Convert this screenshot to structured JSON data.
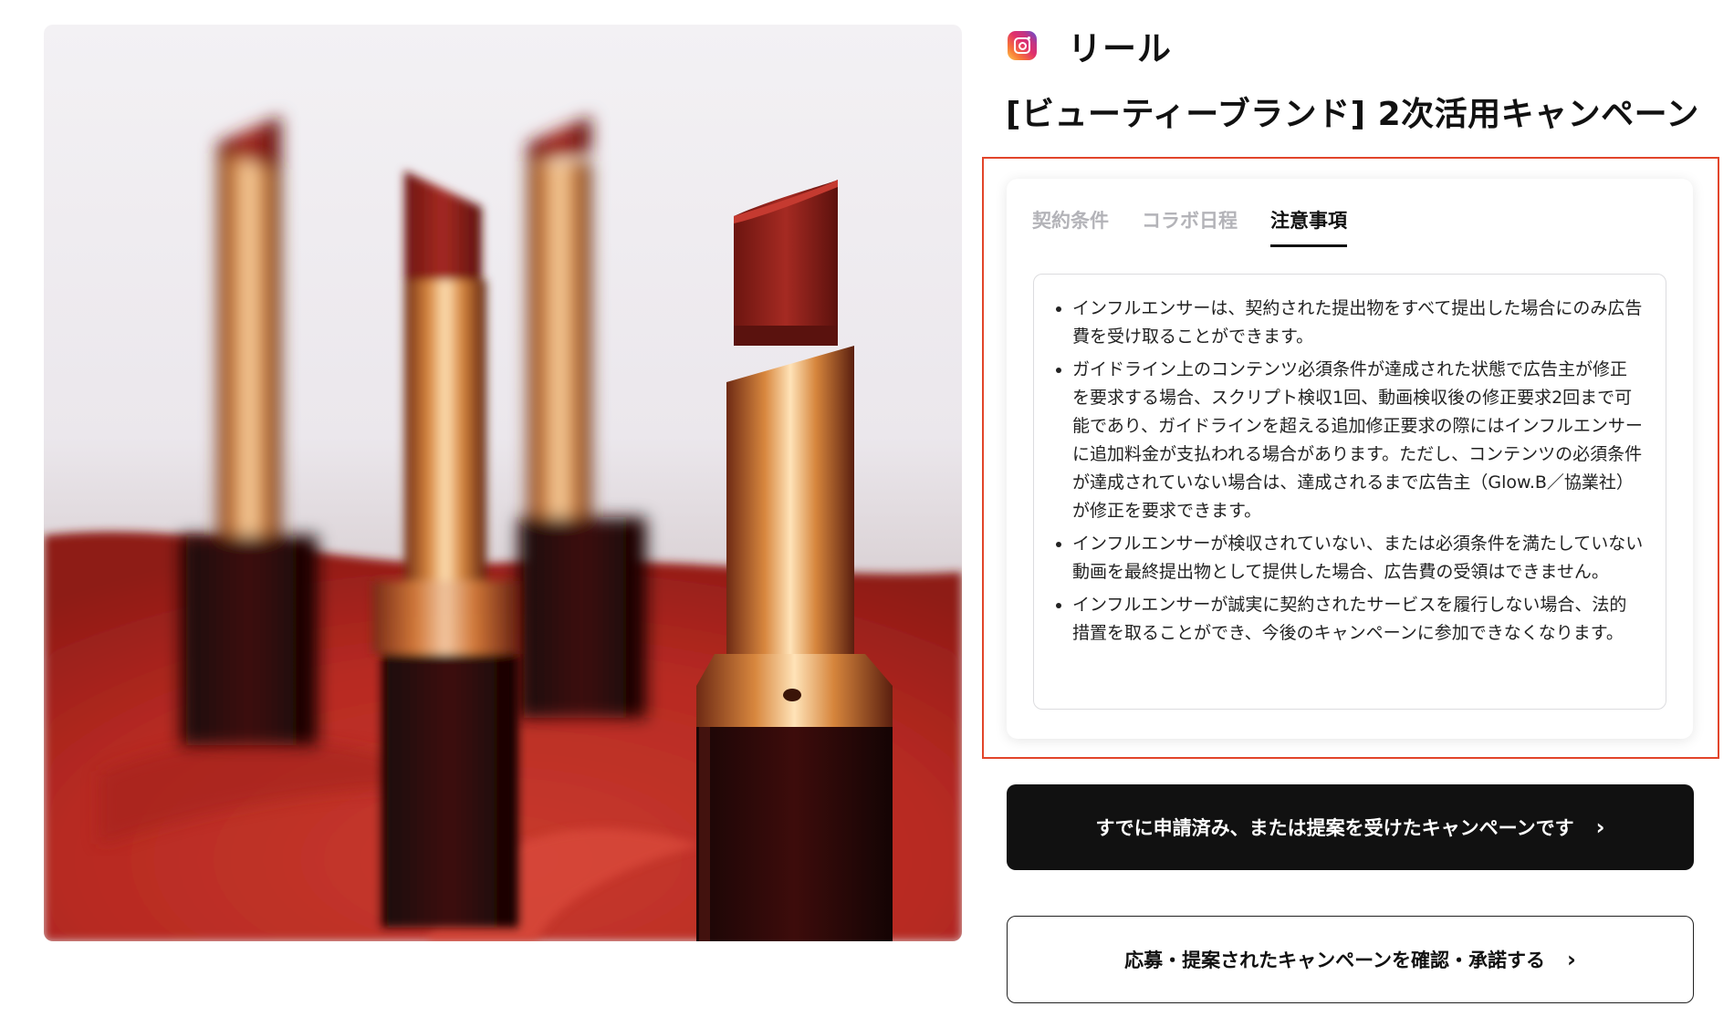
{
  "header": {
    "platform_icon": "instagram-icon",
    "platform_label": "リール",
    "campaign_title": "[ビューティーブランド] 2次活用キャンペーン"
  },
  "tabs": [
    {
      "label": "契約条件",
      "active": false
    },
    {
      "label": "コラボ日程",
      "active": false
    },
    {
      "label": "注意事項",
      "active": true
    }
  ],
  "notes": [
    "インフルエンサーは、契約された提出物をすべて提出した場合にのみ広告費を受け取ることができます。",
    "ガイドライン上のコンテンツ必須条件が達成された状態で広告主が修正を要求する場合、スクリプト検収1回、動画検収後の修正要求2回まで可能であり、ガイドラインを超える追加修正要求の際にはインフルエンサーに追加料金が支払われる場合があります。ただし、コンテンツの必須条件が達成されていない場合は、達成されるまで広告主（Glow.B／協業社）が修正を要求できます。",
    "インフルエンサーが検収されていない、または必須条件を満たしていない動画を最終提出物として提供した場合、広告費の受領はできません。",
    "インフルエンサーが誠実に契約されたサービスを履行しない場合、法的措置を取ることができ、今後のキャンペーンに参加できなくなります。"
  ],
  "buttons": {
    "primary_label": "すでに申請済み、または提案を受けたキャンペーンです",
    "secondary_label": "応募・提案されたキャンペーンを確認・承諾する",
    "chevron": "›"
  },
  "colors": {
    "highlight": "#e2452a",
    "primary_button": "#111111"
  }
}
